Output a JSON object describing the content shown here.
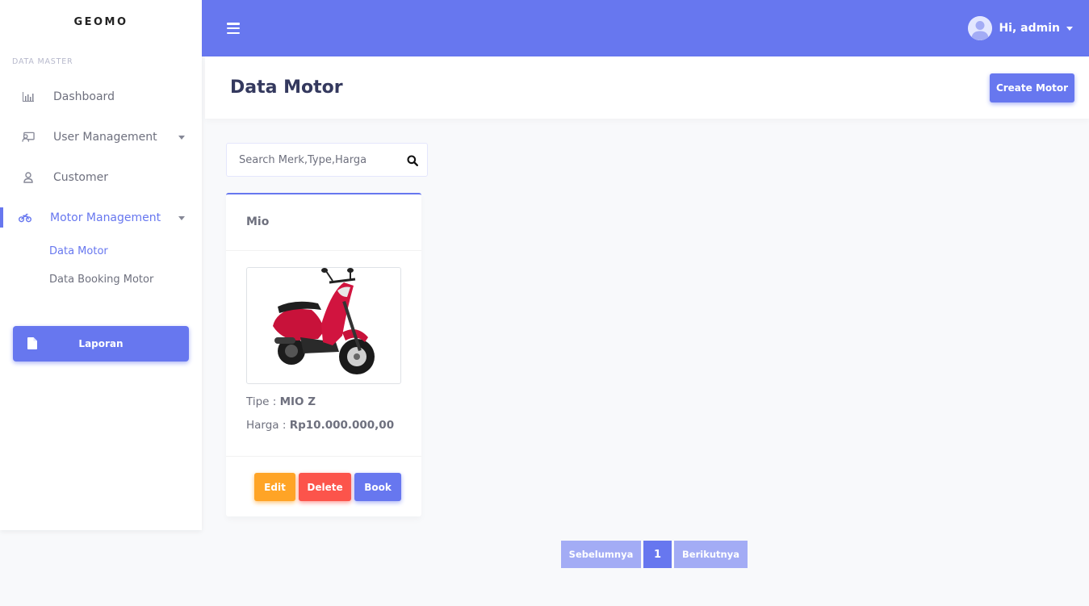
{
  "sidebar": {
    "brand": "GEOMO",
    "section_heading": "DATA MASTER",
    "items": [
      {
        "label": "Dashboard",
        "icon": "chart-bar-icon"
      },
      {
        "label": "User Management",
        "icon": "user-tie-icon"
      },
      {
        "label": "Customer",
        "icon": "user-icon"
      },
      {
        "label": "Motor Management",
        "icon": "motorcycle-icon"
      }
    ],
    "sub_items": [
      {
        "label": "Data Motor"
      },
      {
        "label": "Data Booking Motor"
      }
    ],
    "report_button": "Laporan"
  },
  "topbar": {
    "menu_icon": "bars-icon",
    "user_greeting": "Hi, admin"
  },
  "header": {
    "title": "Data Motor",
    "create_button": "Create Motor"
  },
  "search": {
    "placeholder": "Search Merk,Type,Harga",
    "value": ""
  },
  "cards": [
    {
      "title": "Mio",
      "type_label": "Tipe : ",
      "type_value": "MIO Z",
      "price_label": "Harga : ",
      "price_value": "Rp10.000.000,00",
      "buttons": {
        "edit": "Edit",
        "delete": "Delete",
        "book": "Book"
      }
    }
  ],
  "pagination": {
    "prev": "Sebelumnya",
    "current": "1",
    "next": "Berikutnya"
  },
  "colors": {
    "primary": "#6777ef",
    "warning": "#ffa426",
    "danger": "#fc544b",
    "motor_red": "#c8123a"
  }
}
